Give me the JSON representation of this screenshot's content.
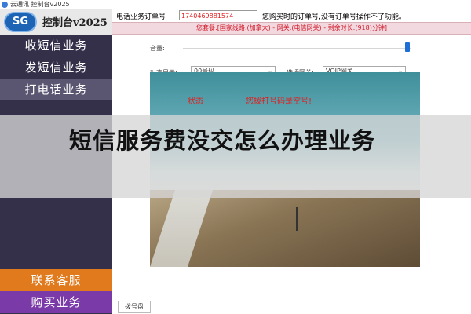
{
  "window": {
    "title": "云通讯 控制台v2025"
  },
  "logo": {
    "badge": "SG",
    "text": "控制台v2025"
  },
  "sidebar": {
    "items": [
      {
        "label": "收短信业务"
      },
      {
        "label": "发短信业务"
      },
      {
        "label": "打电话业务"
      }
    ],
    "contact": "联系客服",
    "buy": "购买业务"
  },
  "form": {
    "order_label": "电话业务订单号",
    "order_value": "1740469881574",
    "order_hint": "您购买时的订单号,没有订单号操作不了功能。"
  },
  "package": {
    "text": "您套餐:[国家线路:(加拿大) - 网关:(电信网关) - 剩余时长:(918)分钟]"
  },
  "controls": {
    "volume_label": "音量:",
    "peer_label": "对方显示:",
    "peer_value": "00号码",
    "gateway_label": "选择网关:",
    "gateway_value": "VOIP网关"
  },
  "call": {
    "status_label": "状态",
    "status_msg": "您拨打号码是空号!"
  },
  "icons": {
    "mic": "microphone-icon",
    "hangup": "phone-hangup-icon",
    "caret": "chevron-down-icon"
  },
  "bottom": {
    "tab": "拨号盘"
  },
  "overlay": {
    "title": "短信服务费没交怎么办理业务"
  },
  "colors": {
    "sidebar_bg": "#34304a",
    "contact_bg": "#e07a1c",
    "buy_bg": "#7a3aa8",
    "hangup": "#e53935",
    "status_text": "#e02020"
  }
}
